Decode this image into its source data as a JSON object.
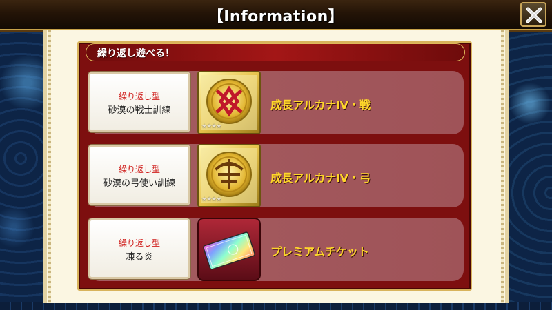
{
  "header": {
    "title": "【Information】"
  },
  "section": {
    "title": "繰り返し遊べる！"
  },
  "rows": [
    {
      "type_label": "繰り返し型",
      "quest_name": "砂漠の戦士訓練",
      "reward_name": "成長アルカナⅣ・戦",
      "icon": "war-arcana-emblem-icon",
      "stars": "★★★★"
    },
    {
      "type_label": "繰り返し型",
      "quest_name": "砂漠の弓使い訓練",
      "reward_name": "成長アルカナⅣ・弓",
      "icon": "bow-arcana-emblem-icon",
      "stars": "★★★★"
    },
    {
      "type_label": "繰り返し型",
      "quest_name": "凍る炎",
      "reward_name": "プレミアムチケット",
      "icon": "premium-ticket-icon"
    }
  ],
  "colors": {
    "accent_gold": "#ffd62a",
    "type_red": "#d0201e",
    "frame_red": "#7d0f0f"
  }
}
